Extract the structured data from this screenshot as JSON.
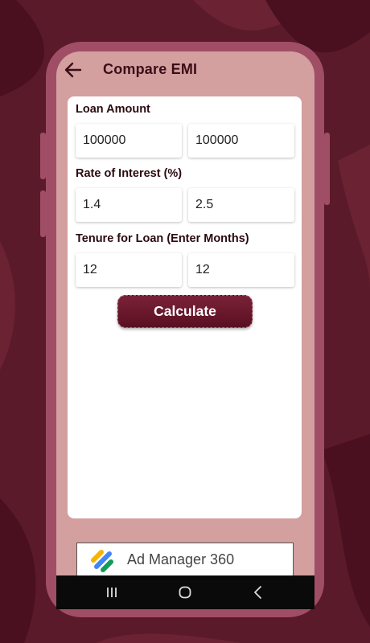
{
  "header": {
    "title": "Compare EMI",
    "back_icon": "arrow-left-icon"
  },
  "form": {
    "loan_amount": {
      "label": "Loan Amount",
      "value_1": "100000",
      "value_2": "100000"
    },
    "rate": {
      "label": "Rate of Interest (%)",
      "value_1": "1.4",
      "value_2": "2.5"
    },
    "tenure": {
      "label": "Tenure for Loan (Enter Months)",
      "value_1": "12",
      "value_2": "12"
    },
    "calculate_label": "Calculate"
  },
  "ad": {
    "text": "Ad Manager 360",
    "logo_icon": "ad-manager-logo"
  },
  "nav": {
    "icons": [
      "recents-icon",
      "home-icon",
      "back-icon"
    ]
  },
  "colors": {
    "background": "#5a1a2a",
    "phone_frame": "#a04e66",
    "screen": "#d39f9f",
    "button": "#6a1a2c",
    "title_text": "#3a0d17"
  }
}
